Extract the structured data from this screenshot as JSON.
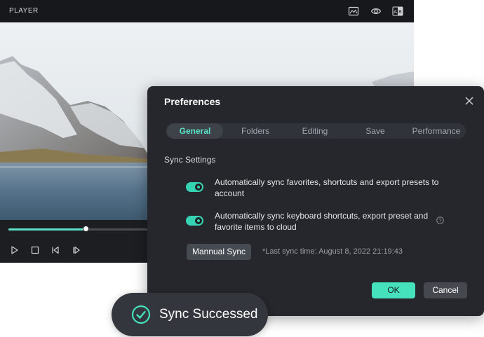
{
  "player": {
    "title": "PLAYER",
    "header_icons": [
      "image-compare-icon",
      "eye-icon",
      "ab-compare-icon"
    ],
    "progress": 0.55,
    "controls": [
      "play-icon",
      "stop-icon",
      "previous-frame-icon",
      "next-frame-icon"
    ]
  },
  "dialog": {
    "title": "Preferences",
    "tabs": [
      {
        "label": "General",
        "active": true
      },
      {
        "label": "Folders",
        "active": false
      },
      {
        "label": "Editing",
        "active": false
      },
      {
        "label": "Save",
        "active": false
      },
      {
        "label": "Performance",
        "active": false
      }
    ],
    "section_title": "Sync Settings",
    "options": [
      {
        "line1": "Automatically sync favorites, shortcuts and export presets to",
        "line2": "account",
        "enabled": true
      },
      {
        "line1": "Automatically sync keyboard shortcuts, export preset and",
        "line2": "favorite items to cloud",
        "enabled": true
      }
    ],
    "manual_sync_label": "Mannual Sync",
    "last_sync_text": "*Last sync time: August 8, 2022 21:19:43",
    "ok_label": "OK",
    "cancel_label": "Cancel"
  },
  "toast": {
    "text": "Sync Successed"
  },
  "colors": {
    "accent": "#45e0bc",
    "dialog_bg": "#25272c",
    "player_bg": "#16181c"
  }
}
